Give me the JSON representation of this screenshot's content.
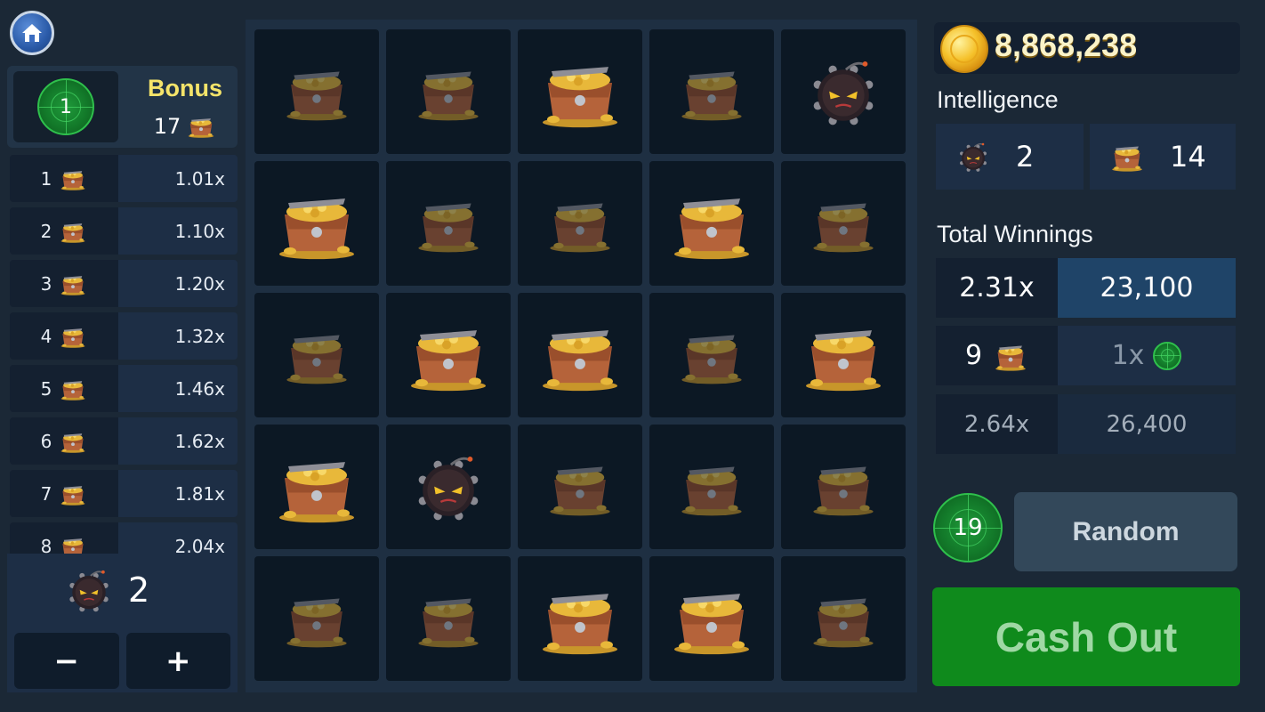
{
  "balance": {
    "value": "8,868,238",
    "icon": "gold-coin-icon"
  },
  "bonus": {
    "title": "Bonus",
    "radar_level": "1",
    "chest_count": "17"
  },
  "multiplier_table": [
    {
      "count": "1",
      "multiplier": "1.01x"
    },
    {
      "count": "2",
      "multiplier": "1.10x"
    },
    {
      "count": "3",
      "multiplier": "1.20x"
    },
    {
      "count": "4",
      "multiplier": "1.32x"
    },
    {
      "count": "5",
      "multiplier": "1.46x"
    },
    {
      "count": "6",
      "multiplier": "1.62x"
    },
    {
      "count": "7",
      "multiplier": "1.81x"
    },
    {
      "count": "8",
      "multiplier": "2.04x"
    }
  ],
  "bomb_selector": {
    "count": "2",
    "minus_label": "−",
    "plus_label": "+"
  },
  "grid": [
    [
      "chest-dim",
      "chest-dim",
      "chest-open",
      "chest-dim",
      "bomb"
    ],
    [
      "chest-open",
      "chest-dim",
      "chest-dim",
      "chest-open",
      "chest-dim"
    ],
    [
      "chest-dim",
      "chest-open",
      "chest-open",
      "chest-dim",
      "chest-open"
    ],
    [
      "chest-open",
      "bomb",
      "chest-dim",
      "chest-dim",
      "chest-dim"
    ],
    [
      "chest-dim",
      "chest-dim",
      "chest-open",
      "chest-open",
      "chest-dim"
    ]
  ],
  "intelligence": {
    "label": "Intelligence",
    "bombs": "2",
    "chests": "14"
  },
  "total_winnings": {
    "label": "Total Winnings",
    "current_multiplier": "2.31x",
    "current_amount": "23,100",
    "picks": "9",
    "radar_multiplier": "1x",
    "next_multiplier": "2.64x",
    "next_amount": "26,400"
  },
  "random": {
    "radar_count": "19",
    "label": "Random"
  },
  "cash_out_label": "Cash Out",
  "colors": {
    "background": "#1b2836",
    "panel": "#1d2e45",
    "cell": "#0c1824",
    "bonus_title": "#f5e46a",
    "cash_out": "#0f8a1c",
    "radar": "#1f9a3a"
  }
}
